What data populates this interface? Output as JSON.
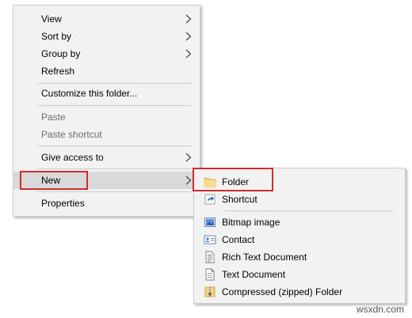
{
  "context_menu": {
    "items": [
      {
        "label": "View",
        "submenu": true
      },
      {
        "label": "Sort by",
        "submenu": true
      },
      {
        "label": "Group by",
        "submenu": true
      },
      {
        "label": "Refresh"
      },
      {
        "label": "Customize this folder..."
      },
      {
        "label": "Paste",
        "disabled": true
      },
      {
        "label": "Paste shortcut",
        "disabled": true
      },
      {
        "label": "Give access to",
        "submenu": true
      },
      {
        "label": "New",
        "submenu": true,
        "highlighted": true
      },
      {
        "label": "Properties"
      }
    ]
  },
  "new_submenu": {
    "items": [
      {
        "label": "Folder",
        "icon": "folder-icon",
        "highlighted": true
      },
      {
        "label": "Shortcut",
        "icon": "shortcut-icon"
      },
      {
        "label": "Bitmap image",
        "icon": "bitmap-image-icon"
      },
      {
        "label": "Contact",
        "icon": "contact-icon"
      },
      {
        "label": "Rich Text Document",
        "icon": "rich-text-document-icon"
      },
      {
        "label": "Text Document",
        "icon": "text-document-icon"
      },
      {
        "label": "Compressed (zipped) Folder",
        "icon": "zip-folder-icon"
      }
    ]
  },
  "colors": {
    "highlight_border": "#d12b2b",
    "menu_bg": "#f2f2f2",
    "hover_bg": "#d9d9d9"
  },
  "watermark": "wsxdn.com"
}
